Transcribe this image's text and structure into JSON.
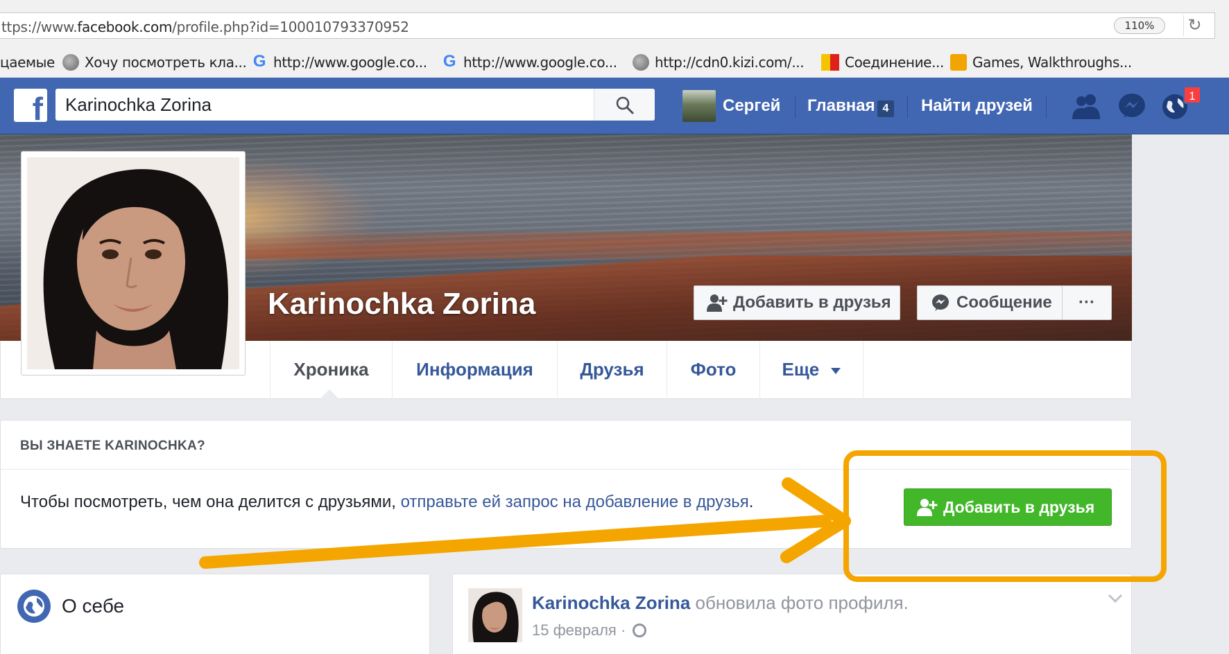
{
  "browser": {
    "url_prefix": "ttps://www.",
    "url_host": "facebook.com",
    "url_path": "/profile.php?id=100010793370952",
    "zoom": "110%",
    "bookmarks": [
      {
        "label": "цаемые",
        "icon": "none"
      },
      {
        "label": "Хочу посмотреть кла...",
        "icon": "globe-icon"
      },
      {
        "label": "http://www.google.co...",
        "icon": "google-icon"
      },
      {
        "label": "http://www.google.co...",
        "icon": "google-icon"
      },
      {
        "label": "http://cdn0.kizi.com/...",
        "icon": "globe-icon"
      },
      {
        "label": "Соединение...",
        "icon": "flag-icon"
      },
      {
        "label": "Games, Walkthroughs...",
        "icon": "rss-icon"
      }
    ]
  },
  "fb_header": {
    "logo": "f",
    "search_value": "Karinochka Zorina",
    "user_name": "Сергей",
    "home_label": "Главная",
    "home_count": "4",
    "find_friends_label": "Найти друзей",
    "notifications_count": "1",
    "brand_color": "#4267b2"
  },
  "profile": {
    "name": "Karinochka Zorina",
    "add_friend_label": "Добавить в друзья",
    "message_label": "Сообщение",
    "more_label": "···",
    "tabs": [
      {
        "label": "Хроника",
        "active": true
      },
      {
        "label": "Информация",
        "active": false
      },
      {
        "label": "Друзья",
        "active": false
      },
      {
        "label": "Фото",
        "active": false
      },
      {
        "label": "Еще",
        "active": false
      }
    ]
  },
  "know_card": {
    "title": "ВЫ ЗНАЕТЕ KARINOCHKA?",
    "text_plain": "Чтобы посмотреть, чем она делится с друзьями, ",
    "text_link": "отправьте ей запрос на добавление в друзья",
    "text_end": ".",
    "button_label": "Добавить в друзья",
    "button_color": "#42b72a"
  },
  "about": {
    "title": "О себе"
  },
  "post": {
    "author": "Karinochka Zorina",
    "action": " обновила фото профиля.",
    "date": "15 февраля",
    "separator": " · "
  },
  "annotation": {
    "color": "#f5a500"
  }
}
